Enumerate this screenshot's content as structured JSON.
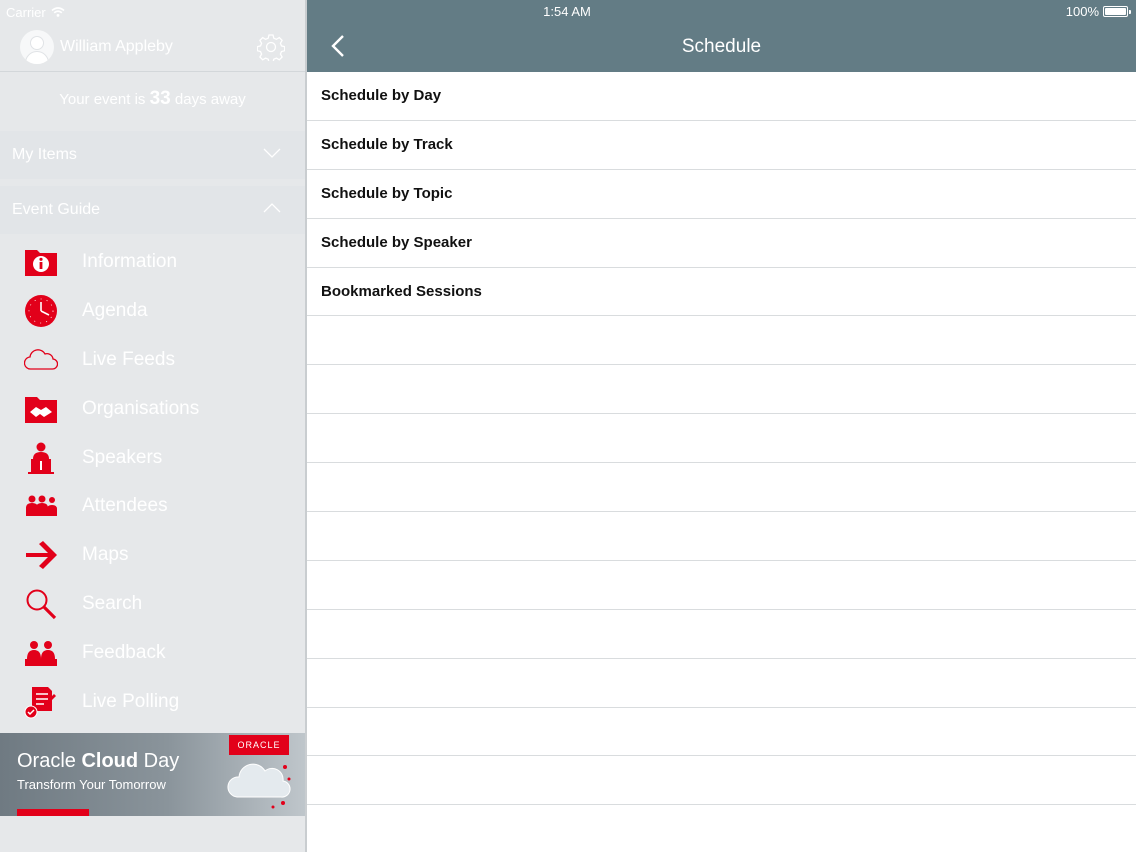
{
  "status_bar": {
    "carrier": "Carrier",
    "time": "1:54 AM",
    "battery": "100%"
  },
  "sidebar": {
    "user_name": "William Appleby",
    "countdown": {
      "prefix": "Your event is",
      "days": "33",
      "suffix": "days away"
    },
    "sections": {
      "my_items": "My Items",
      "event_guide": "Event Guide"
    },
    "menu": [
      {
        "label": "Information",
        "icon": "information-icon"
      },
      {
        "label": "Agenda",
        "icon": "clock-icon"
      },
      {
        "label": "Live Feeds",
        "icon": "cloud-icon"
      },
      {
        "label": "Organisations",
        "icon": "handshake-icon"
      },
      {
        "label": "Speakers",
        "icon": "speaker-icon"
      },
      {
        "label": "Attendees",
        "icon": "attendees-icon"
      },
      {
        "label": "Maps",
        "icon": "arrow-right-icon"
      },
      {
        "label": "Search",
        "icon": "search-icon"
      },
      {
        "label": "Feedback",
        "icon": "feedback-icon"
      },
      {
        "label": "Live Polling",
        "icon": "polling-icon"
      }
    ],
    "banner": {
      "logo": "ORACLE",
      "title_regular_1": "Oracle ",
      "title_bold": "Cloud",
      "title_regular_2": " Day",
      "subtitle": "Transform Your Tomorrow"
    }
  },
  "main": {
    "title": "Schedule",
    "items": [
      "Schedule by Day",
      "Schedule by Track",
      "Schedule by Topic",
      "Schedule by Speaker",
      "Bookmarked Sessions"
    ]
  },
  "colors": {
    "navbar": "#637c85",
    "accent_red": "#e2001a",
    "sidebar_bg": "#e6e8ea"
  }
}
